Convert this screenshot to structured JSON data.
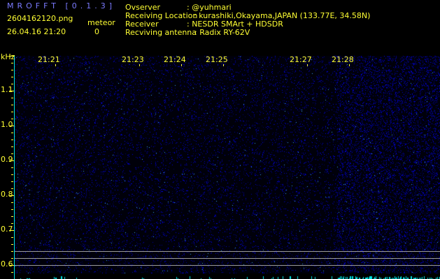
{
  "header": {
    "title": "MROFFT [0.1.3]",
    "filename": "2604162120.png",
    "datetime": "26.04.16 21:20",
    "meteor_label": "meteor",
    "meteor_count": "0"
  },
  "info": [
    {
      "label": "Ovserver",
      "value": ": @yuhmari"
    },
    {
      "label": "Receiving Location",
      "value": ": kurashiki,Okayama,JAPAN (133.77E, 34.58N)"
    },
    {
      "label": "Receiver",
      "value": ": NESDR SMArt + HDSDR"
    },
    {
      "label": "Recviving antenna",
      "value": ": Radix RY-62V"
    }
  ],
  "axis": {
    "unit": "kHz",
    "freq_labels": [
      {
        "text": "1.1",
        "khz": 1.1
      },
      {
        "text": "1.0",
        "khz": 1.0
      },
      {
        "text": "0.9",
        "khz": 0.9
      },
      {
        "text": "0.8",
        "khz": 0.8
      },
      {
        "text": "0.7",
        "khz": 0.7
      },
      {
        "text": "0.6",
        "khz": 0.6
      }
    ],
    "time_labels": [
      {
        "text": "21:21",
        "minute": 1
      },
      {
        "text": "21:23",
        "minute": 3
      },
      {
        "text": "21:24",
        "minute": 4
      },
      {
        "text": "21:25",
        "minute": 5
      },
      {
        "text": "21:27",
        "minute": 7
      },
      {
        "text": "21:28",
        "minute": 8
      }
    ],
    "guide_lines_khz": [
      0.62,
      0.6,
      0.58
    ]
  },
  "colors": {
    "text": "#ffff33",
    "title": "#7b7bff",
    "noise": "#1a1aff",
    "axis": "#00e5e5",
    "guide": "#9a9a9a"
  }
}
